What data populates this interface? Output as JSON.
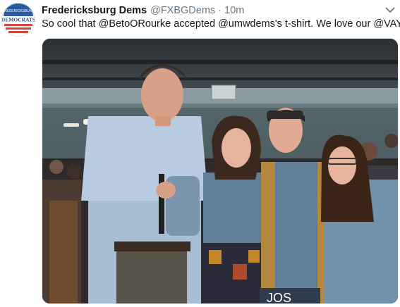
{
  "tweet": {
    "avatar_icon": "democrat-logo-avatar",
    "avatar_text": "FREDERICKSBURG DEMOCRATS",
    "display_name": "Fredericksburg Dems",
    "handle": "@FXBGDems",
    "separator": "·",
    "timestamp": "10m",
    "text": "So cool that @BetoORourke accepted @umwdems's t-shirt. We love our @VAYD!",
    "menu_icon": "chevron-down-icon",
    "photo": {
      "description_icon": "group-photo",
      "sign_text": "JOS"
    }
  },
  "colors": {
    "text": "#14171a",
    "secondary": "#657786",
    "brand_red": "#d4483b",
    "brand_blue": "#1f4d8a"
  }
}
